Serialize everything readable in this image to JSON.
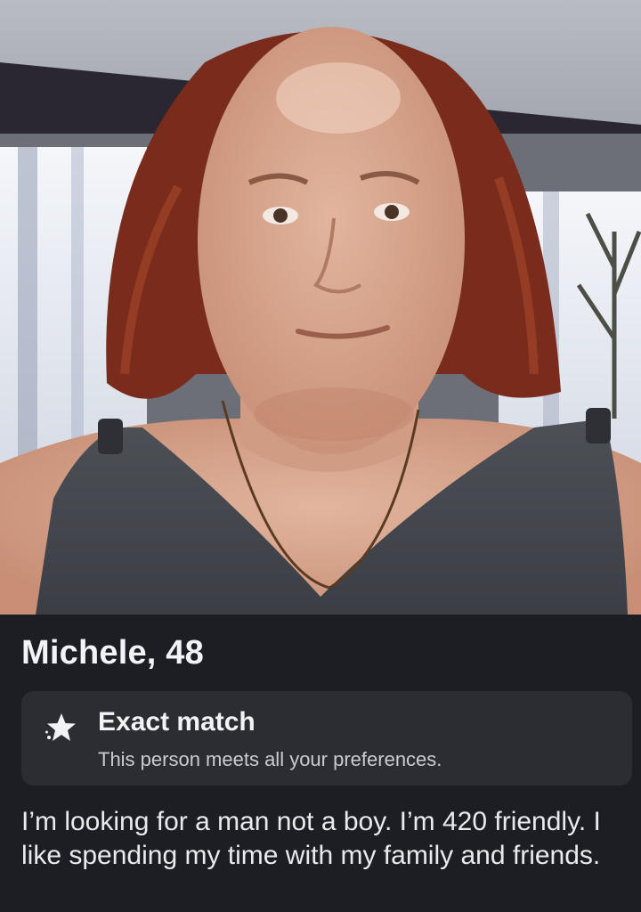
{
  "profile": {
    "name_age": "Michele, 48",
    "badge": {
      "icon": "sparkle-star-icon",
      "title": "Exact match",
      "subtitle": "This person meets all your preferences."
    },
    "bio": "I’m looking for a man not a boy. I’m 420 friendly. I like spending my time with my family and friends."
  },
  "colors": {
    "background": "#1c1e24",
    "card": "#2b2d33",
    "text_primary": "#f2f3f5",
    "text_secondary": "#c9ccd2"
  }
}
